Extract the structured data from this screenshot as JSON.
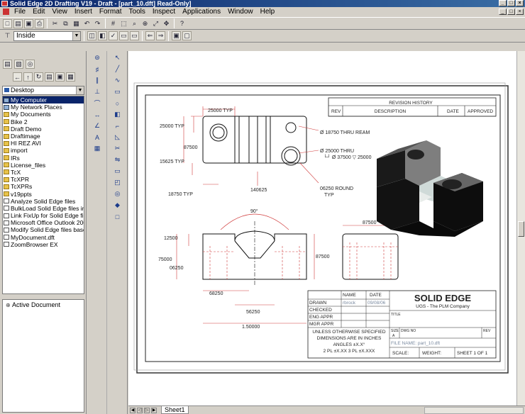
{
  "window": {
    "title": "Solid Edge 2D Drafting V19 - Draft - [part_10.dft] Read-Only]"
  },
  "menu": [
    "File",
    "Edit",
    "View",
    "Insert",
    "Format",
    "Tools",
    "Inspect",
    "Applications",
    "Window",
    "Help"
  ],
  "toolbar2": {
    "layer_value": "Inside"
  },
  "library": {
    "path": "Desktop",
    "items": [
      {
        "label": "My Computer",
        "icon": "computer"
      },
      {
        "label": "My Network Places",
        "icon": "computer"
      },
      {
        "label": "My Documents",
        "icon": "folder"
      },
      {
        "label": "Bike 2",
        "icon": "folder"
      },
      {
        "label": "Draft Demo",
        "icon": "folder"
      },
      {
        "label": "Draftimage",
        "icon": "folder"
      },
      {
        "label": "HI REZ AVI",
        "icon": "folder"
      },
      {
        "label": "import",
        "icon": "folder"
      },
      {
        "label": "IRs",
        "icon": "folder"
      },
      {
        "label": "License_files",
        "icon": "folder"
      },
      {
        "label": "TcX",
        "icon": "folder"
      },
      {
        "label": "TcXPR",
        "icon": "folder"
      },
      {
        "label": "TcXPRs",
        "icon": "folder"
      },
      {
        "label": "v19ppts",
        "icon": "folder"
      },
      {
        "label": "Analyze Solid Edge files",
        "icon": "doc"
      },
      {
        "label": "BulkLoad Solid Edge files into",
        "icon": "doc"
      },
      {
        "label": "Link FixUp for Solid Edge files",
        "icon": "doc"
      },
      {
        "label": "Microsoft Office Outlook 2003",
        "icon": "doc"
      },
      {
        "label": "Modify Solid Edge files based",
        "icon": "doc"
      },
      {
        "label": "MyDocument.dft",
        "icon": "doc"
      },
      {
        "label": "ZoomBrowser EX",
        "icon": "doc"
      }
    ]
  },
  "active_document": {
    "label": "Active Document"
  },
  "drawing": {
    "revision_history": {
      "title": "REVISION HISTORY",
      "headers": [
        "REV",
        "DESCRIPTION",
        "DATE",
        "APPROVED"
      ]
    },
    "dims": {
      "top_width": "25000 TYP",
      "left_top": "25000 TYP",
      "left_mid": "87500",
      "left_bot": "15625 TYP",
      "bottom_left": "18750 TYP",
      "hole_mid": "140625",
      "thru_ream": "Ø 18750 THRU REAM",
      "cbore_1": "Ø 25000 THRU",
      "cbore_2": "└┘ Ø 37500 ▽ 25000",
      "round": "06250 ROUND",
      "round_typ": "TYP",
      "angle": "90°",
      "front_12500": "12500",
      "front_75000": "75000",
      "front_06250": "06250",
      "front_87500": "87500",
      "front_68250": "68250",
      "front_56250": "56250",
      "front_150000": "1.50000",
      "side_87500": "87500"
    },
    "title_block": {
      "col_name": "NAME",
      "col_date": "DATE",
      "rows": [
        {
          "label": "DRAWN",
          "name": "rbrock",
          "date": "09/08/06"
        },
        {
          "label": "CHECKED",
          "name": "",
          "date": ""
        },
        {
          "label": "ENG APPR",
          "name": "",
          "date": ""
        },
        {
          "label": "MGR APPR",
          "name": "",
          "date": ""
        }
      ],
      "company": "SOLID EDGE",
      "company_sub": "UGS - The PLM Company",
      "title_label": "TITLE",
      "notes": [
        "UNLESS OTHERWISE SPECIFIED",
        "DIMENSIONS ARE IN INCHES",
        "ANGLES ±X.X°",
        "2 PL ±X.XX 3 PL ±X.XXX"
      ],
      "size_label": "SIZE",
      "size_value": "A",
      "dwg_label": "DWG NO",
      "rev_label": "REV",
      "file_name": "FILE NAME: part_10.dft",
      "scale": "SCALE:",
      "weight": "WEIGHT:",
      "sheet": "SHEET 1 OF 1"
    }
  },
  "sheet_tab": "Sheet1"
}
